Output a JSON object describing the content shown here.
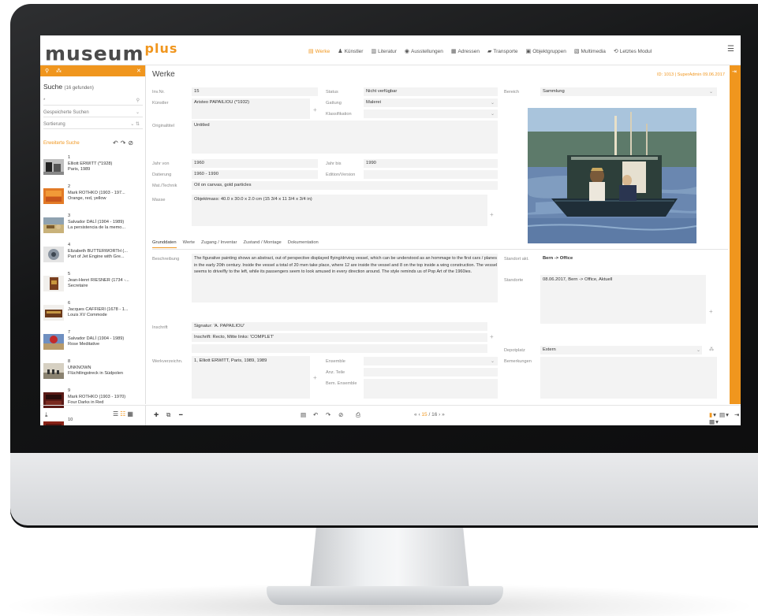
{
  "app": {
    "logo_main": "museum",
    "logo_plus": "plus"
  },
  "topnav": [
    {
      "label": "Werke",
      "icon": "works-icon",
      "glyph": "▤",
      "active": true
    },
    {
      "label": "Künstler",
      "icon": "person-icon",
      "glyph": "♟",
      "active": false
    },
    {
      "label": "Literatur",
      "icon": "book-icon",
      "glyph": "▥",
      "active": false
    },
    {
      "label": "Ausstellungen",
      "icon": "eye-icon",
      "glyph": "◉",
      "active": false
    },
    {
      "label": "Adressen",
      "icon": "address-card-icon",
      "glyph": "▦",
      "active": false
    },
    {
      "label": "Transporte",
      "icon": "truck-icon",
      "glyph": "▰",
      "active": false
    },
    {
      "label": "Objektgruppen",
      "icon": "object-groups-icon",
      "glyph": "▣",
      "active": false
    },
    {
      "label": "Multimedia",
      "icon": "film-icon",
      "glyph": "▧",
      "active": false
    },
    {
      "label": "Letztes Modul",
      "icon": "history-icon",
      "glyph": "⟲",
      "active": false
    }
  ],
  "sidebar": {
    "search_title": "Suche",
    "search_count": "(16 gefunden)",
    "search_value": "*",
    "saved_searches": "Gespeicherte Suchen",
    "sorting": "Sortierung",
    "advanced_search": "Erweiterte Suche",
    "results": [
      {
        "num": "1",
        "artist": "Elliott ERWITT (*1928)",
        "title": "Paris, 1989",
        "thumb": "photo-bw"
      },
      {
        "num": "2",
        "artist": "Mark ROTHKO (1903 - 197...",
        "title": "Orange, red, yellow",
        "thumb": "rothko-orange"
      },
      {
        "num": "3",
        "artist": "Salvador DALÍ (1904 - 1989)",
        "title": "La persistencia de la memo...",
        "thumb": "dali-landscape"
      },
      {
        "num": "4",
        "artist": "Elizabeth BUTTERWORTH (...",
        "title": "Part of Jet Engine with Gre...",
        "thumb": "jet-engine"
      },
      {
        "num": "5",
        "artist": "Jean-Henri RIESNER (1734 -...",
        "title": "Secretaire",
        "thumb": "secretaire"
      },
      {
        "num": "6",
        "artist": "Jacques CAFFIERI (1678 - 1...",
        "title": "Louis XV Commode",
        "thumb": "commode"
      },
      {
        "num": "7",
        "artist": "Salvador DALÍ (1904 - 1989)",
        "title": "Rose Meditative",
        "thumb": "rose"
      },
      {
        "num": "8",
        "artist": "UNKNOWN",
        "title": "Flüchtlingstreck in Südpolen",
        "thumb": "refugees"
      },
      {
        "num": "9",
        "artist": "Mark ROTHKO (1903 - 1970)",
        "title": "Four Darks in Red",
        "thumb": "rothko-dark"
      },
      {
        "num": "10",
        "artist": "",
        "title": "",
        "thumb": "rothko-last"
      }
    ]
  },
  "main": {
    "page_title": "Werke",
    "record_id": "ID: 1013 | SuperAdmin 09.06.2017",
    "fields": {
      "invnr_label": "Inv.Nr.",
      "invnr_value": "15",
      "status_label": "Status",
      "status_value": "Nicht verfügbar",
      "bereich_label": "Bereich",
      "bereich_value": "Sammlung",
      "kuenstler_label": "Künstler",
      "kuenstler_value": "Aristeo PAPAILIOU (*1932)",
      "gattung_label": "Gattung",
      "gattung_value": "Malerei",
      "klassifikation_label": "Klassifikation",
      "originaltitel_label": "Originaltitel",
      "originaltitel_value": "Untitled",
      "jahr_von_label": "Jahr von",
      "jahr_von_value": "1960",
      "jahr_bis_label": "Jahr bis",
      "jahr_bis_value": "1990",
      "datierung_label": "Datierung",
      "datierung_value": "1960 - 1990",
      "edition_label": "Edition/Version",
      "technik_label": "Mat./Technik",
      "technik_value": "Oil on canvas, gold particles",
      "masse_label": "Masse",
      "masse_value": "Objektmass: 40.0 x 30.0 x 2.0 cm (15 3/4 x 11 3/4 x 3/4 in)"
    },
    "tabs": [
      "Grunddaten",
      "Werte",
      "Zugang / Inventar",
      "Zustand / Montage",
      "Dokumentation"
    ],
    "detail": {
      "beschreibung_label": "Beschreibung",
      "beschreibung_value": "The figurative painting shows an abstract, out of perspective displayed flying/driving vessel, which can be understood as an hommage to the first cars / planes in the early 20th century. Inside the vessel a total of 20 men take place, where 12 are inside the vessel and 8 on the top inside a wing construction. The vessel seems to drive/fly to the left, while its passengers seem to look amused in every direction around. The style reminds us of Pop Art of the 1960ies.",
      "inschrift_label": "Inschrift",
      "inschrift_1": "Signatur: 'A. PAPAILIOU'",
      "inschrift_2": "Inschrift: Recto, Mitte links: 'COMPLET'",
      "werkverz_label": "Werkverzeichn.",
      "werkverz_value": "1, Elliott ERWITT, Paris, 1989, 1989",
      "ensemble_label": "Ensemble",
      "anz_teile_label": "Anz. Teile",
      "bem_ensemble_label": "Bem. Ensemble",
      "standort_akt_label": "Standort akt.",
      "standort_akt_value": "Bern -> Office",
      "standorte_label": "Standorte",
      "standorte_value": "08.06.2017, Bern -> Office, Aktuell",
      "depotplatz_label": "Depotplatz",
      "depotplatz_value": "Extern",
      "bemerkungen_label": "Bemerkungen"
    }
  },
  "pager": {
    "current": "15",
    "total": "16",
    "separator": "/"
  },
  "colors": {
    "accent": "#f0961e"
  }
}
